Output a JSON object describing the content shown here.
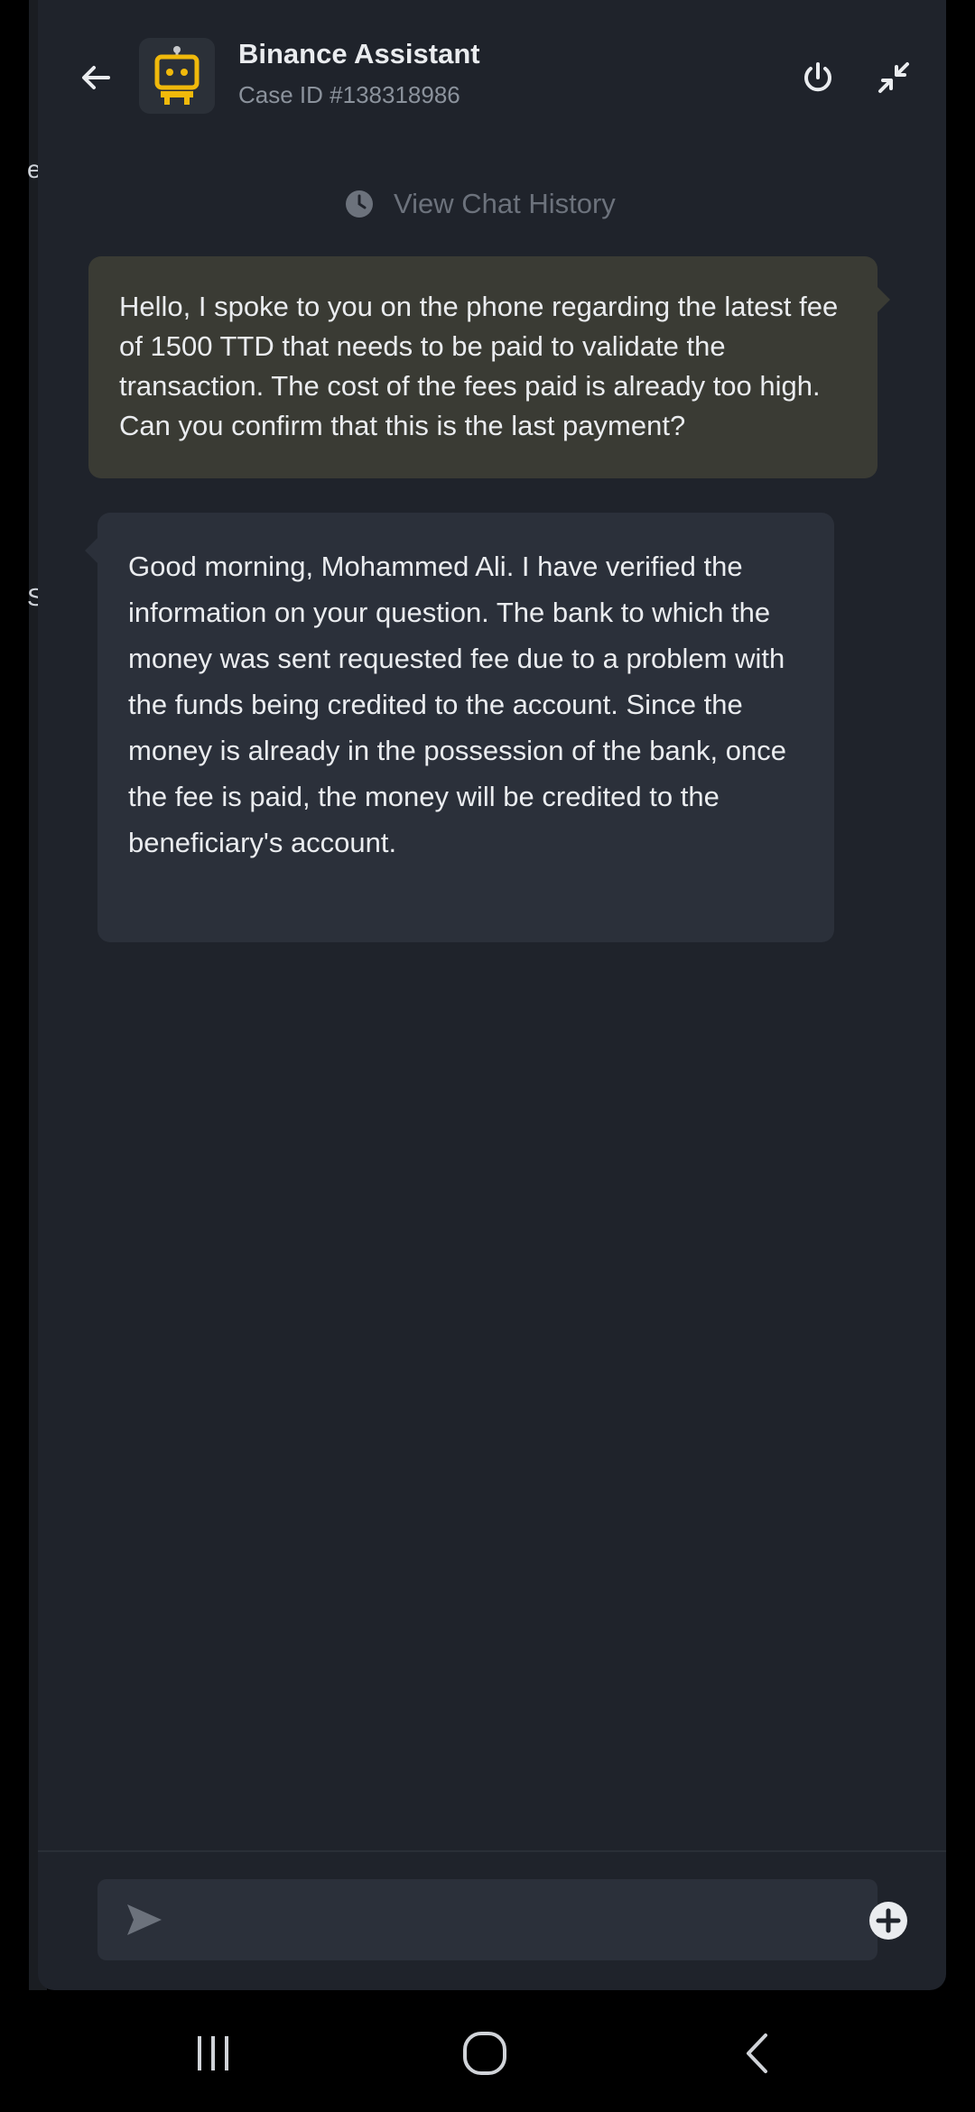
{
  "header": {
    "title": "Binance Assistant",
    "case_id": "Case ID #138318986"
  },
  "history_link": "View Chat History",
  "messages": [
    {
      "sender": "user",
      "text": "Hello, I spoke to you on the phone regarding the latest fee of 1500 TTD that needs to be paid to validate the transaction. The cost of the fees paid is already too high. Can you confirm that this is the last payment?"
    },
    {
      "sender": "assistant",
      "text": "Good morning, Mohammed Ali. I have verified the information on your question. The bank to which the money was sent requested fee due to a problem with the funds being credited to the account. Since the money is already in the possession of the bank, once the fee is paid, the money will be credited to the beneficiary's account."
    }
  ],
  "input": {
    "value": "",
    "placeholder": ""
  },
  "background_chars": [
    "e",
    "S"
  ],
  "icons": {
    "back": "arrow-left-icon",
    "avatar": "robot-icon",
    "power": "power-icon",
    "minimize": "minimize-icon",
    "history": "clock-icon",
    "send": "send-icon",
    "attach": "plus-circle-icon"
  },
  "colors": {
    "panel_bg": "#1f232b",
    "user_bubble": "#3a3b34",
    "bot_bubble": "#2b303a",
    "brand_yellow": "#f0b90b",
    "text_primary": "#eaecef",
    "text_secondary": "#8b929c"
  }
}
